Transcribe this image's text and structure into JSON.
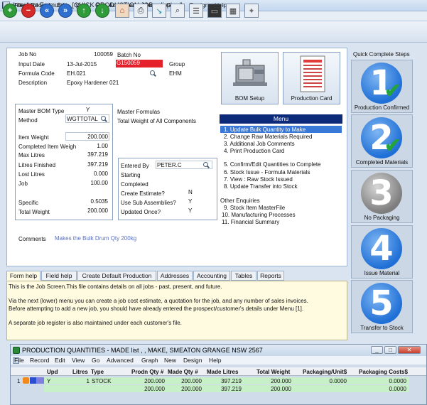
{
  "window": {
    "title": "InterAcct Formulas - [QUICK PRODUCTION JOB - display ]"
  },
  "menubar": [
    "File",
    "Record",
    "Edit",
    "View",
    "Go",
    "Advanced",
    "Menu",
    "Graph",
    "Design",
    "Help"
  ],
  "toolbar": [
    {
      "icon": "add-icon",
      "color": "#2f9b3b"
    },
    {
      "icon": "delete-icon",
      "color": "#d42a2a"
    },
    {
      "icon": "first-record-icon",
      "color": "#2f6fd0"
    },
    {
      "icon": "last-record-icon",
      "color": "#2f6fd0"
    },
    {
      "icon": "up-arrow-icon",
      "color": "#2f9b3b"
    },
    {
      "icon": "down-arrow-icon",
      "color": "#2f9b3b"
    },
    {
      "icon": "home-icon"
    },
    {
      "icon": "printer-icon"
    },
    {
      "icon": "pin-icon"
    },
    {
      "icon": "search-icon"
    },
    {
      "icon": "form-icon"
    },
    {
      "icon": "monitor-icon"
    },
    {
      "icon": "grid-icon"
    },
    {
      "icon": "tools-icon"
    }
  ],
  "job": {
    "job_no_label": "Job No",
    "job_no": "100059",
    "batch_no_label": "Batch No",
    "batch_no": "G150059",
    "input_date_label": "Input Date",
    "input_date": "13-Jul-2015",
    "group_label": "Group",
    "group": "EHM",
    "formula_code_label": "Formula Code",
    "formula_code": "EH.021",
    "description_label": "Description",
    "description": "Epoxy Hardener 021"
  },
  "bom": {
    "master_bom_type_label": "Master BOM Type",
    "master_bom_type": "Y",
    "method_label": "Method",
    "method": "WGTTOTAL",
    "item_weight_label": "Item Weight",
    "item_weight": "200.000",
    "completed_item_weight_label": "Completed Item Weigh",
    "completed_item_weight": "1.00",
    "max_litres_label": "Max Litres",
    "max_litres": "397.219",
    "litres_finished_label": "Litres Finished",
    "litres_finished": "397.219",
    "lost_litres_label": "Lost Litres",
    "lost_litres": "0.000",
    "job_label": "Job",
    "job": "100.00",
    "specific_label": "Specific",
    "specific": "0.5035",
    "total_weight_label": "Total Weight",
    "total_weight": "200.000"
  },
  "master_formulas_label": "Master Formulas",
  "total_weight_all_label": "Total Weight of All Components",
  "entry": {
    "entered_by_label": "Entered By",
    "entered_by": "PETER.C",
    "starting_label": "Starting",
    "completed_label": "Completed",
    "create_estimate_label": "Create Estimate?",
    "create_estimate": "N",
    "use_sub_assemblies_label": "Use Sub Assemblies?",
    "use_sub_assemblies": "Y",
    "updated_once_label": "Updated Once?",
    "updated_once": "Y"
  },
  "comments_label": "Comments",
  "comments": "Makes the Bulk Drum Qty 200kg",
  "big_buttons": {
    "bom_setup": "BOM Setup",
    "production_card": "Production Card"
  },
  "menu": {
    "title": "Menu",
    "items": [
      "1. Update Bulk Quantity to Make",
      "2. Change Raw Materials Required",
      "3. Additional Job Comments",
      "4. Print Production Card",
      "5. Confirm/Edit Quantities to Complete",
      "6. Stock Issue - Formula Materials",
      "7. View : Raw Stock Issued",
      "8. Update Transfer into Stock",
      "Other Enquiries",
      "9. Stock Item MasterFile",
      "10. Manufacturing Processes",
      "11. Financial Summary"
    ]
  },
  "quick_complete": {
    "title": "Quick Complete Steps",
    "steps": [
      {
        "number": "1",
        "label": "Production Confirmed",
        "color": "#1f6fd6",
        "done": true
      },
      {
        "number": "2",
        "label": "Completed Materials",
        "color": "#1f6fd6",
        "done": true
      },
      {
        "number": "3",
        "label": "No Packaging",
        "color": "#8c8c8c",
        "done": false
      },
      {
        "number": "4",
        "label": "Issue Material",
        "color": "#1f6fd6",
        "done": false
      },
      {
        "number": "5",
        "label": "Transfer to Stock",
        "color": "#1f6fd6",
        "done": false
      }
    ]
  },
  "tabs": [
    "Form help",
    "Field help",
    "Create Default Production",
    "Addresses",
    "Accounting",
    "Tables",
    "Reports"
  ],
  "help_text": [
    "This is the Job Screen.This file contains details on all jobs - past, present, and future.",
    "Via the next (lower) menu you can create a job cost estimate, a quotation for the job, and any number of sales invoices.",
    "Before attempting to add a new job, you should have already entered the prospect/customer's details under Menu [1].",
    "A separate job register is also maintained under each customer's file."
  ],
  "child_window": {
    "title": "PRODUCTION QUANTITIES - MADE list , , MAKE, SMEATON GRANGE NSW 2567",
    "menubar": [
      "File",
      "Record",
      "Edit",
      "View",
      "Go",
      "Advanced",
      "Graph",
      "New",
      "Design",
      "Help"
    ],
    "columns": [
      "Upd",
      "Litres",
      "Type",
      "Prodn Qty #",
      "Made Qty #",
      "Made Litres",
      "Total Weight",
      "Packaging/Unit$",
      "Packaging Costs$"
    ],
    "rows": [
      {
        "num": "1",
        "upd": "Y",
        "litres": "1",
        "type": "STOCK",
        "prodn_qty": "200.000",
        "made_qty": "200.000",
        "made_litres": "397.219",
        "total_weight": "200.000",
        "packaging_unit": "0.0000",
        "packaging_costs": "0.0000"
      },
      {
        "num": "",
        "upd": "",
        "litres": "",
        "type": "",
        "prodn_qty": "200.000",
        "made_qty": "200.000",
        "made_litres": "397.219",
        "total_weight": "200.000",
        "packaging_unit": "",
        "packaging_costs": "0.0000"
      }
    ]
  }
}
